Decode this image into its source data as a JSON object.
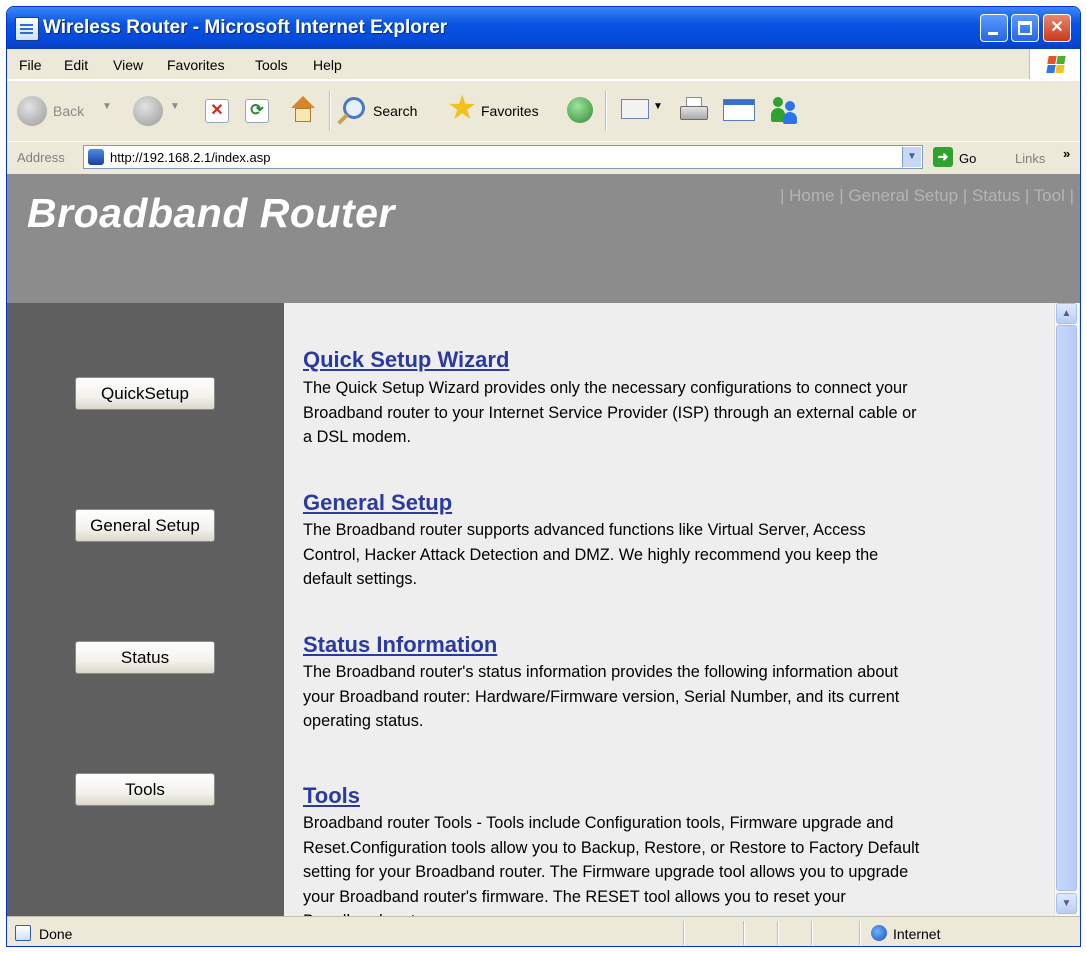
{
  "window": {
    "title": "Wireless Router - Microsoft Internet Explorer",
    "buttons": {
      "minimize": "",
      "maximize": "",
      "close": "✕"
    }
  },
  "menu": [
    "File",
    "Edit",
    "View",
    "Favorites",
    "Tools",
    "Help"
  ],
  "toolbar": {
    "back": "Back",
    "forward": "",
    "stop": "",
    "refresh": "",
    "home": "",
    "search": "Search",
    "favorites": "Favorites",
    "history": "",
    "mail": "",
    "print": "",
    "edit": "",
    "messenger": ""
  },
  "address": {
    "label": "Address",
    "url": "http://192.168.2.1/index.asp",
    "go": "Go",
    "links": "Links"
  },
  "page": {
    "brand": "Broadband Router",
    "topnav": [
      "Home",
      "General Setup",
      "Status",
      "Tool"
    ],
    "sidebar_buttons": [
      "QuickSetup",
      "General Setup",
      "Status",
      "Tools"
    ],
    "sections": [
      {
        "title": "Quick Setup Wizard",
        "body": "The Quick Setup Wizard provides only the necessary configurations to connect your Broadband router to your Internet Service Provider (ISP) through an external cable or a DSL modem."
      },
      {
        "title": "General Setup",
        "body": "The Broadband router supports advanced functions like Virtual Server, Access Control, Hacker Attack Detection and DMZ. We highly recommend you keep the default settings."
      },
      {
        "title": "Status Information",
        "body": "The Broadband router's status information provides the following information about your Broadband router: Hardware/Firmware version, Serial Number, and its current operating status."
      },
      {
        "title": "Tools",
        "body": "Broadband router Tools - Tools include Configuration tools, Firmware upgrade and Reset.Configuration tools allow you to Backup, Restore, or Restore to Factory Default setting for your Broadband router. The Firmware upgrade tool allows you to upgrade your Broadband router's firmware. The RESET tool allows you to reset your Broadband router."
      }
    ]
  },
  "status": {
    "text": "Done",
    "zone": "Internet"
  },
  "colors": {
    "header_bg": "#8c8c8c",
    "sidebar_bg": "#5f5f5f",
    "main_bg": "#eeeeee",
    "link": "#2b3a9e",
    "titlebar": "#0a54e3"
  }
}
